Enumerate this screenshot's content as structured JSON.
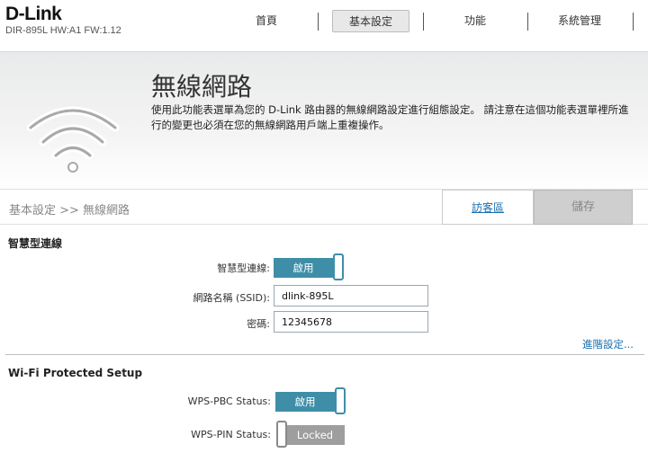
{
  "header": {
    "brand": "D-Link",
    "model_line": "DIR-895L HW:A1 FW:1.12",
    "nav": [
      {
        "label": "首頁",
        "active": false
      },
      {
        "label": "基本設定",
        "active": true
      },
      {
        "label": "功能",
        "active": false
      },
      {
        "label": "系統管理",
        "active": false
      }
    ]
  },
  "banner": {
    "icon": "wifi-icon",
    "title": "無線網路",
    "description": "使用此功能表選單為您的 D-Link 路由器的無線網路設定進行組態設定。 請注意在這個功能表選單裡所進行的變更也必須在您的無線網路用戶端上重複操作。"
  },
  "crumb_bar": {
    "breadcrumb": "基本設定 >> 無線網路",
    "guest_link": "訪客區",
    "save_label": "儲存"
  },
  "smart_connect": {
    "section_title": "智慧型連線",
    "toggle_label": "智慧型連線:",
    "toggle_value": "啟用",
    "ssid_label": "網路名稱 (SSID):",
    "ssid_value": "dlink-895L",
    "password_label": "密碼:",
    "password_value": "12345678",
    "advanced_link": "進階設定..."
  },
  "wps": {
    "section_title": "Wi-Fi Protected Setup",
    "pbc_label": "WPS-PBC Status:",
    "pbc_value": "啟用",
    "pin_label": "WPS-PIN Status:",
    "pin_value": "Locked"
  },
  "colors": {
    "accent": "#3f8ea8",
    "link": "#1a6fb0",
    "disabled": "#9e9e9e"
  }
}
